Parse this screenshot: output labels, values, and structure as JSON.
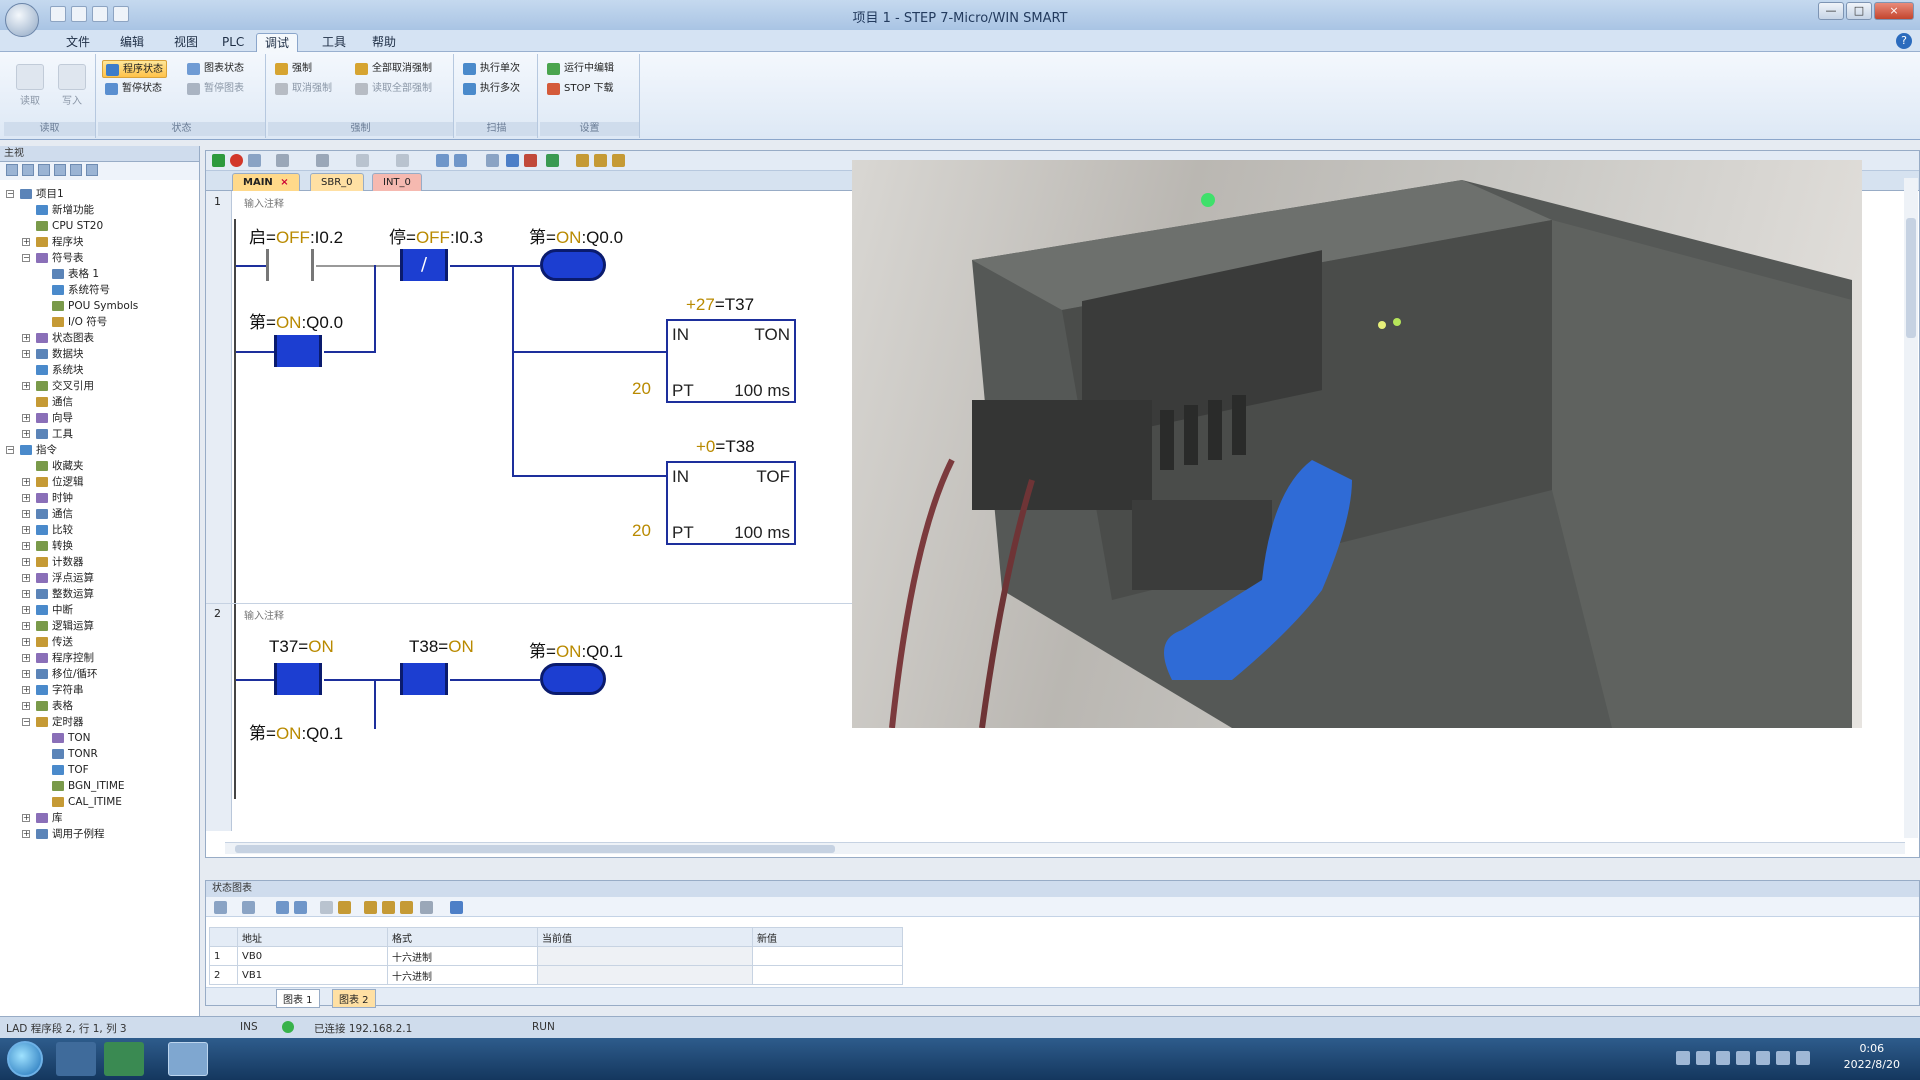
{
  "window": {
    "title": "项目 1 - STEP 7-Micro/WIN SMART",
    "controls": [
      "—",
      "□",
      "×"
    ],
    "help": "?"
  },
  "menu": [
    "文件",
    "编辑",
    "视图",
    "PLC",
    "调试",
    "工具",
    "帮助"
  ],
  "ribbon": {
    "groups": [
      {
        "label": "读取",
        "buttons": [
          "读取",
          "写入"
        ]
      },
      {
        "label": "状态",
        "buttons": [
          "程序状态",
          "暂停状态",
          "图表状态",
          "暂停图表"
        ]
      },
      {
        "label": "强制",
        "buttons": [
          "强制",
          "取消强制",
          "全部取消强制",
          "读取全部强制"
        ]
      },
      {
        "label": "扫描",
        "buttons": [
          "执行单次",
          "执行多次"
        ]
      },
      {
        "label": "设置",
        "buttons": [
          "运行中编辑",
          "STOP 下载"
        ]
      }
    ]
  },
  "left_panel": {
    "title": "主视",
    "tree": [
      {
        "label": "项目1",
        "level": 0,
        "expander": "−"
      },
      {
        "label": "新增功能",
        "level": 1,
        "expander": ""
      },
      {
        "label": "CPU ST20",
        "level": 1,
        "expander": ""
      },
      {
        "label": "程序块",
        "level": 1,
        "expander": "+"
      },
      {
        "label": "符号表",
        "level": 1,
        "expander": "−"
      },
      {
        "label": "表格 1",
        "level": 2,
        "expander": ""
      },
      {
        "label": "系统符号",
        "level": 2,
        "expander": ""
      },
      {
        "label": "POU Symbols",
        "level": 2,
        "expander": ""
      },
      {
        "label": "I/O 符号",
        "level": 2,
        "expander": ""
      },
      {
        "label": "状态图表",
        "level": 1,
        "expander": "+"
      },
      {
        "label": "数据块",
        "level": 1,
        "expander": "+"
      },
      {
        "label": "系统块",
        "level": 1,
        "expander": ""
      },
      {
        "label": "交叉引用",
        "level": 1,
        "expander": "+"
      },
      {
        "label": "通信",
        "level": 1,
        "expander": ""
      },
      {
        "label": "向导",
        "level": 1,
        "expander": "+"
      },
      {
        "label": "工具",
        "level": 1,
        "expander": "+"
      },
      {
        "label": "指令",
        "level": 0,
        "expander": "−"
      },
      {
        "label": "收藏夹",
        "level": 1,
        "expander": ""
      },
      {
        "label": "位逻辑",
        "level": 1,
        "expander": "+"
      },
      {
        "label": "时钟",
        "level": 1,
        "expander": "+"
      },
      {
        "label": "通信",
        "level": 1,
        "expander": "+"
      },
      {
        "label": "比较",
        "level": 1,
        "expander": "+"
      },
      {
        "label": "转换",
        "level": 1,
        "expander": "+"
      },
      {
        "label": "计数器",
        "level": 1,
        "expander": "+"
      },
      {
        "label": "浮点运算",
        "level": 1,
        "expander": "+"
      },
      {
        "label": "整数运算",
        "level": 1,
        "expander": "+"
      },
      {
        "label": "中断",
        "level": 1,
        "expander": "+"
      },
      {
        "label": "逻辑运算",
        "level": 1,
        "expander": "+"
      },
      {
        "label": "传送",
        "level": 1,
        "expander": "+"
      },
      {
        "label": "程序控制",
        "level": 1,
        "expander": "+"
      },
      {
        "label": "移位/循环",
        "level": 1,
        "expander": "+"
      },
      {
        "label": "字符串",
        "level": 1,
        "expander": "+"
      },
      {
        "label": "表格",
        "level": 1,
        "expander": "+"
      },
      {
        "label": "定时器",
        "level": 1,
        "expander": "−"
      },
      {
        "label": "TON",
        "level": 2,
        "expander": ""
      },
      {
        "label": "TONR",
        "level": 2,
        "expander": ""
      },
      {
        "label": "TOF",
        "level": 2,
        "expander": ""
      },
      {
        "label": "BGN_ITIME",
        "level": 2,
        "expander": ""
      },
      {
        "label": "CAL_ITIME",
        "level": 2,
        "expander": ""
      },
      {
        "label": "库",
        "level": 1,
        "expander": "+"
      },
      {
        "label": "调用子例程",
        "level": 1,
        "expander": "+"
      }
    ]
  },
  "tabs": [
    {
      "label": "MAIN",
      "active": true,
      "close": "×"
    },
    {
      "label": "SBR_0",
      "active": false
    },
    {
      "label": "INT_0",
      "active": false
    }
  ],
  "networks": [
    {
      "number": "1",
      "comment": "输入注释",
      "contacts": [
        {
          "symbol": "启",
          "state": "OFF",
          "address": "I0.2"
        },
        {
          "symbol": "停",
          "state": "OFF",
          "address": "I0.3",
          "glyph": "/"
        },
        {
          "symbol": "第",
          "state": "ON",
          "address": "Q0.0"
        }
      ],
      "timers": [
        {
          "value": "+27",
          "name": "T37",
          "type": "TON",
          "in": "IN",
          "pt_label": "PT",
          "pt": "20",
          "unit": "100 ms"
        },
        {
          "value": "+0",
          "name": "T38",
          "type": "TOF",
          "in": "IN",
          "pt_label": "PT",
          "pt": "20",
          "unit": "100 ms"
        }
      ],
      "coil": {
        "symbol": "第",
        "state": "ON",
        "address": "Q0.0"
      }
    },
    {
      "number": "2",
      "comment": "输入注释",
      "contacts": [
        {
          "symbol": "",
          "state": "ON",
          "address": "T37"
        },
        {
          "symbol": "",
          "state": "ON",
          "address": "T38"
        },
        {
          "symbol": "第",
          "state": "ON",
          "address": "Q0.1"
        }
      ],
      "coil": {
        "symbol": "第",
        "state": "ON",
        "address": "Q0.1"
      }
    }
  ],
  "status_chart": {
    "title": "状态图表",
    "headers": [
      "地址",
      "格式",
      "当前值",
      "新值"
    ],
    "rows": [
      {
        "n": "1",
        "address": "VB0",
        "format": "十六进制",
        "current": "",
        "new": ""
      },
      {
        "n": "2",
        "address": "VB1",
        "format": "十六进制",
        "current": "",
        "new": ""
      }
    ],
    "sheet_tabs": [
      "图表 1",
      "图表 2"
    ]
  },
  "status_bar": {
    "mode": "LAD 程序段 2, 行 1, 列 3",
    "ins": "INS",
    "connection": "已连接 192.168.2.1",
    "run": "RUN"
  },
  "taskbar": {
    "time": "0:06",
    "date": "2022/8/20"
  },
  "colors": {
    "energized": "#1c3ed1",
    "wire": "#1d2f9c",
    "state_text": "#b98a00"
  }
}
